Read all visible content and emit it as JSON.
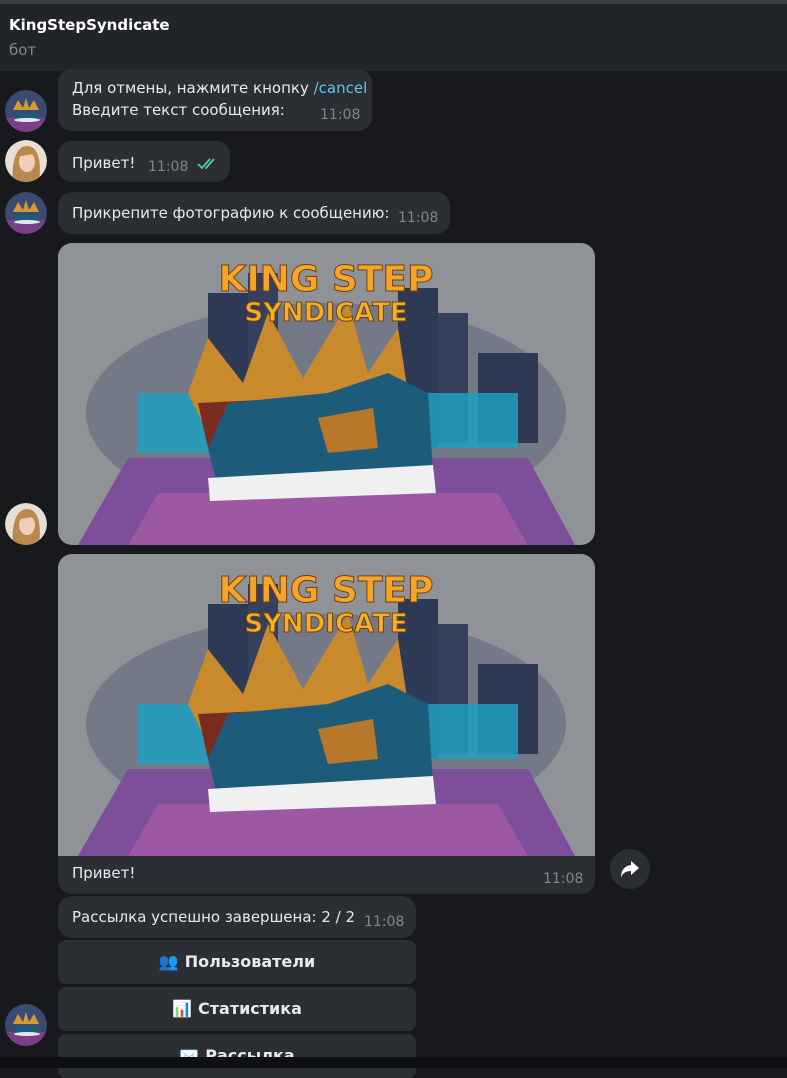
{
  "header": {
    "title": "KingStepSyndicate",
    "subtitle": "бот"
  },
  "messages": {
    "m1": {
      "text_prefix": "Для отмены, нажмите кнопку ",
      "command": "/cancel",
      "line2": "Введите текст сообщения:",
      "time": "11:08"
    },
    "m2": {
      "text": "Привет!",
      "time": "11:08"
    },
    "m3": {
      "text": "Прикрепите фотографию к сообщению:",
      "time": "11:08"
    },
    "m4": {
      "image": "king-step-syndicate-poster"
    },
    "m5": {
      "image": "king-step-syndicate-poster",
      "caption": "Привет!",
      "time": "11:08"
    },
    "m6": {
      "text": "Рассылка успешно завершена: 2 / 2",
      "time": "11:08"
    }
  },
  "poster": {
    "line1": "KING STEP",
    "line2": "SYNDICATE"
  },
  "keyboard": [
    {
      "icon": "👥",
      "label": "Пользователи"
    },
    {
      "icon": "📊",
      "label": "Статистика"
    },
    {
      "icon": "✉️",
      "label": "Рассылка"
    }
  ],
  "colors": {
    "accent": "#62c6e8",
    "bubble": "#2b2e33",
    "background": "#17191d",
    "header": "#212429"
  }
}
